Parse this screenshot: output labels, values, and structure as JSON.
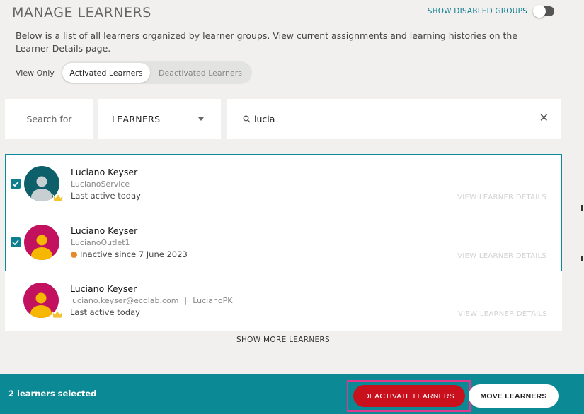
{
  "header": {
    "title": "MANAGE LEARNERS",
    "disabled_groups_label": "SHOW DISABLED GROUPS"
  },
  "description": "Below is a list of all learners organized by learner groups. View current assignments and learning histories on the Learner Details page.",
  "view_filter": {
    "label": "View Only",
    "options": [
      "Activated Learners",
      "Deactivated Learners"
    ],
    "selected": "Activated Learners"
  },
  "search": {
    "label": "Search for",
    "type_value": "LEARNERS",
    "query": "lucia"
  },
  "learners": [
    {
      "name": "Luciano Keyser",
      "username": "LucianoService",
      "username2": "",
      "status": "Last active today",
      "inactive": false,
      "selected": true,
      "details_label": "VIEW LEARNER DETAILS",
      "avatar_color": "#0d5f69",
      "avatar_figure": "#c8cfd3",
      "crown": true
    },
    {
      "name": "Luciano Keyser",
      "username": "LucianoOutlet1",
      "username2": "",
      "status": "Inactive since 7 June 2023",
      "inactive": true,
      "selected": true,
      "details_label": "VIEW LEARNER DETAILS",
      "avatar_color": "#c2125f",
      "avatar_figure": "#f6b700",
      "crown": false
    },
    {
      "name": "Luciano Keyser",
      "username": "luciano.keyser@ecolab.com",
      "separator": "|",
      "username2": "LucianoPK",
      "status": "Last active today",
      "inactive": false,
      "selected": false,
      "details_label": "VIEW LEARNER DETAILS",
      "avatar_color": "#c2125f",
      "avatar_figure": "#f6b700",
      "crown": true
    }
  ],
  "show_more_label": "SHOW MORE LEARNERS",
  "footer": {
    "selected_count": "2 learners selected",
    "deactivate_label": "DEACTIVATE LEARNERS",
    "move_label": "MOVE LEARNERS"
  },
  "colors": {
    "teal": "#0b8a96",
    "deactivate_red": "#c9101d",
    "highlight_pink": "#e0398c",
    "inactive_orange": "#e7892b",
    "crown_gold": "#f2c230"
  },
  "icons": {
    "search": "magnifier-icon",
    "clear": "close-icon",
    "dropdown": "caret-down-icon",
    "checkbox": "checkmark-icon",
    "crown": "crown-icon"
  }
}
